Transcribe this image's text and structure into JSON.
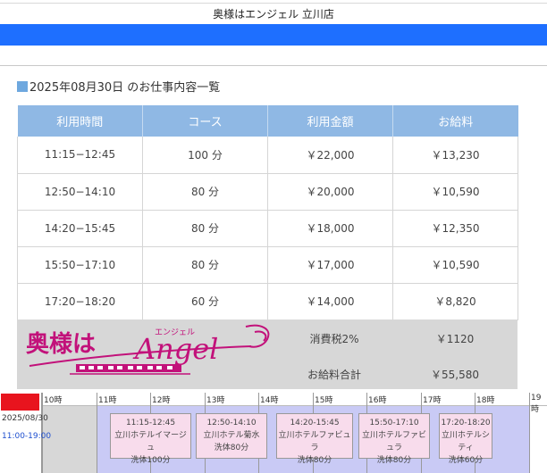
{
  "shop_name": "奥様はエンジェル 立川店",
  "heading": "2025年08月30日 のお仕事内容一覧",
  "table": {
    "headers": [
      "利用時間",
      "コース",
      "利用金額",
      "お給料"
    ],
    "rows": [
      [
        "11:15−12:45",
        "100 分",
        "￥22,000",
        "￥13,230"
      ],
      [
        "12:50−14:10",
        "80 分",
        "￥20,000",
        "￥10,590"
      ],
      [
        "14:20−15:45",
        "80 分",
        "￥18,000",
        "￥12,350"
      ],
      [
        "15:50−17:10",
        "80 分",
        "￥17,000",
        "￥10,590"
      ],
      [
        "17:20−18:20",
        "60 分",
        "￥14,000",
        "￥8,820"
      ]
    ]
  },
  "summary": {
    "tax_label": "消費税2%",
    "tax_value": "￥1120",
    "total_label": "お給料合計",
    "total_value": "￥55,580"
  },
  "logo": {
    "main": "奥様は",
    "script": "Angel",
    "kana": "エンジェル",
    "color": "#c2117a"
  },
  "schedule": {
    "date": "2025/08/30",
    "shift": "11:00-19:00",
    "hours": [
      "10時",
      "11時",
      "12時",
      "13時",
      "14時",
      "15時",
      "16時",
      "17時",
      "18時",
      "19時"
    ],
    "blocks": [
      {
        "time": "11:15-12:45",
        "hotel": "立川ホテルイマージュ",
        "course": "洗体100分"
      },
      {
        "time": "12:50-14:10",
        "hotel": "立川ホテル菊水",
        "course": "洗体80分"
      },
      {
        "time": "14:20-15:45",
        "hotel": "立川ホテルファビュラ",
        "course": "洗体80分"
      },
      {
        "time": "15:50-17:10",
        "hotel": "立川ホテルファビュラ",
        "course": "洗体80分"
      },
      {
        "time": "17:20-18:20",
        "hotel": "立川ホテルシティ",
        "course": "洗体60分"
      }
    ]
  },
  "colors": {
    "header_blue": "#1e6fff",
    "table_header": "#8fb8e4",
    "schedule_block": "#f8dcec",
    "schedule_shift": "#c9caf5",
    "date_red": "#e8141e"
  }
}
